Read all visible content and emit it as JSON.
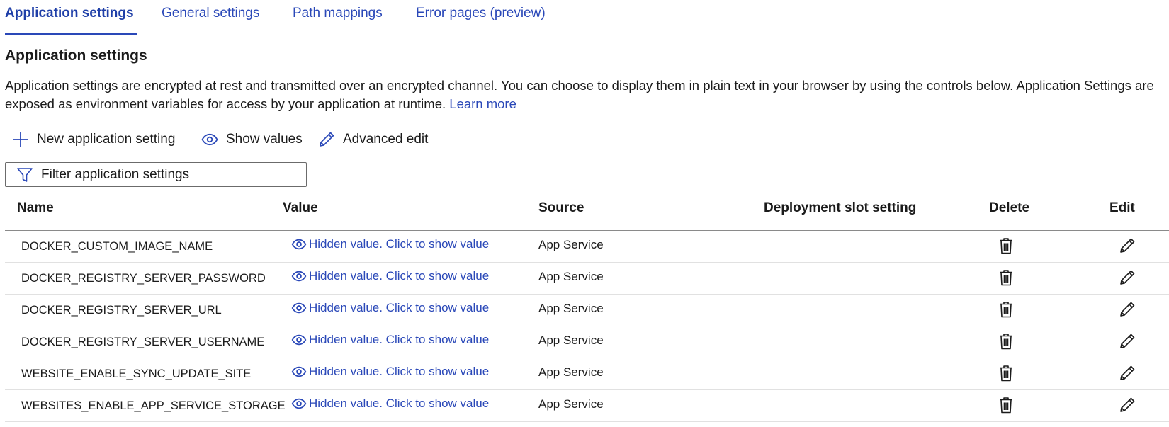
{
  "tabs": [
    {
      "label": "Application settings",
      "active": true
    },
    {
      "label": "General settings",
      "active": false
    },
    {
      "label": "Path mappings",
      "active": false
    },
    {
      "label": "Error pages (preview)",
      "active": false
    }
  ],
  "section": {
    "title": "Application settings",
    "description": "Application settings are encrypted at rest and transmitted over an encrypted channel. You can choose to display them in plain text in your browser by using the controls below. Application Settings are exposed as environment variables for access by your application at runtime.",
    "learn_more": "Learn more"
  },
  "toolbar": {
    "new_label": "New application setting",
    "show_label": "Show values",
    "advanced_label": "Advanced edit"
  },
  "filter": {
    "placeholder": "Filter application settings"
  },
  "table": {
    "headers": {
      "name": "Name",
      "value": "Value",
      "source": "Source",
      "slot": "Deployment slot setting",
      "delete": "Delete",
      "edit": "Edit"
    },
    "rows": [
      {
        "name": "DOCKER_CUSTOM_IMAGE_NAME",
        "value": "Hidden value. Click to show value",
        "source": "App Service"
      },
      {
        "name": "DOCKER_REGISTRY_SERVER_PASSWORD",
        "value": "Hidden value. Click to show value",
        "source": "App Service"
      },
      {
        "name": "DOCKER_REGISTRY_SERVER_URL",
        "value": "Hidden value. Click to show value",
        "source": "App Service"
      },
      {
        "name": "DOCKER_REGISTRY_SERVER_USERNAME",
        "value": "Hidden value. Click to show value",
        "source": "App Service"
      },
      {
        "name": "WEBSITE_ENABLE_SYNC_UPDATE_SITE",
        "value": "Hidden value. Click to show value",
        "source": "App Service"
      },
      {
        "name": "WEBSITES_ENABLE_APP_SERVICE_STORAGE",
        "value": "Hidden value. Click to show value",
        "source": "App Service"
      }
    ]
  },
  "icons": {
    "add": "plus-icon",
    "show": "eye-icon",
    "advanced": "pencil-icon",
    "filter": "funnel-icon",
    "delete": "trash-icon",
    "edit": "pencil-icon"
  },
  "colors": {
    "accent": "#2a48b8",
    "text": "#1b1b1b",
    "border": "#6b6b6b"
  }
}
